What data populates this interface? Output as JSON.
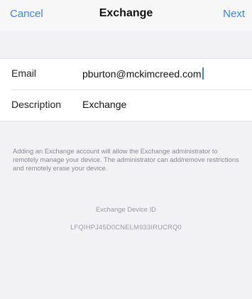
{
  "nav": {
    "cancel": "Cancel",
    "title": "Exchange",
    "next": "Next"
  },
  "form": {
    "email_label": "Email",
    "email_value": "pburton@mckimcreed.com",
    "description_label": "Description",
    "description_value": "Exchange"
  },
  "note": "Adding an Exchange account will allow the Exchange administrator to remotely manage your device. The administrator can add/remove restrictions and remotely erase your device.",
  "device": {
    "label": "Exchange Device ID",
    "id": "LFQIHPJ45D0CNELM933IRUCRQ0"
  },
  "colors": {
    "accent": "#3b82f6",
    "background": "#f2f2f4"
  }
}
